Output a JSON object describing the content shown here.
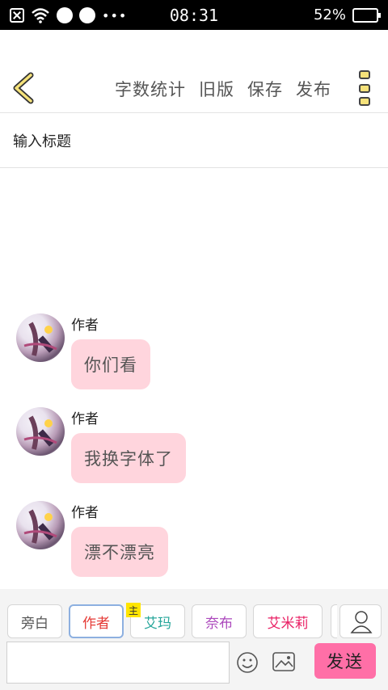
{
  "status_bar": {
    "time": "08:31",
    "battery_percent": "52%",
    "battery_level": 0.52,
    "overflow_dots": "•••"
  },
  "toolbar": {
    "back_icon": "chevron-left-icon",
    "actions": [
      "字数统计",
      "旧版",
      "保存",
      "发布"
    ],
    "more_icon": "vertical-dots-icon"
  },
  "title_field": {
    "placeholder": "输入标题"
  },
  "messages": [
    {
      "author": "作者",
      "text": "你们看"
    },
    {
      "author": "作者",
      "text": "我换字体了"
    },
    {
      "author": "作者",
      "text": "漂不漂亮"
    }
  ],
  "roles": [
    {
      "label": "旁白",
      "color": "#555555"
    },
    {
      "label": "作者",
      "color": "#e53935"
    },
    {
      "label": "艾玛",
      "color": "#26a69a",
      "badge": "主"
    },
    {
      "label": "奈布",
      "color": "#ab47bc"
    },
    {
      "label": "艾米莉",
      "color": "#e91e63"
    }
  ],
  "composer": {
    "send_label": "发送",
    "emoji_icon": "smiley-icon",
    "image_icon": "image-icon",
    "add_role_icon": "person-icon"
  },
  "colors": {
    "bubble": "#ffd5dd",
    "send": "#ff6fa7",
    "accent_yellow": "#f5e27a"
  }
}
